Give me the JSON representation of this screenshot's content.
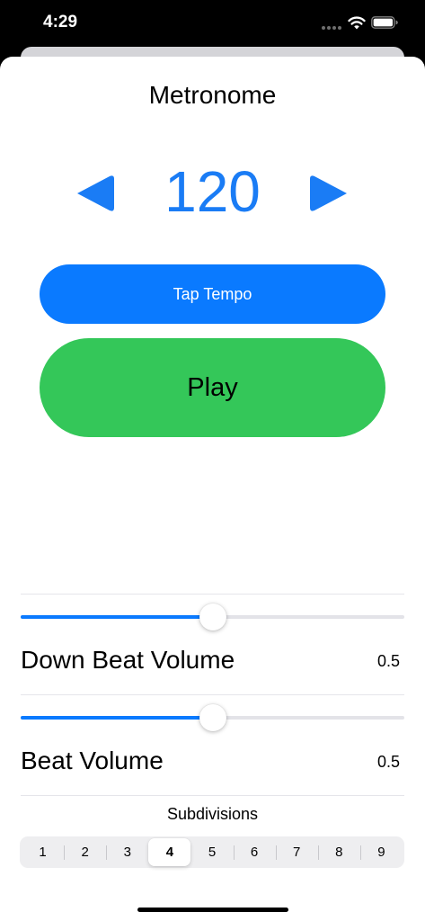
{
  "status_bar": {
    "time": "4:29",
    "icons": [
      "signal-icon",
      "wifi-icon",
      "battery-icon"
    ]
  },
  "page": {
    "title": "Metronome"
  },
  "tempo": {
    "value": "120",
    "decrease_icon": "chevron-left-icon",
    "increase_icon": "chevron-right-icon"
  },
  "buttons": {
    "tap_tempo": "Tap Tempo",
    "play": "Play"
  },
  "down_beat": {
    "label": "Down Beat Volume",
    "value_text": "0.5",
    "level": 0.5
  },
  "beat": {
    "label": "Beat Volume",
    "value_text": "0.5",
    "level": 0.5
  },
  "subdivisions": {
    "title": "Subdivisions",
    "options": [
      "1",
      "2",
      "3",
      "4",
      "5",
      "6",
      "7",
      "8",
      "9"
    ],
    "selected": "4"
  },
  "colors": {
    "accent_blue": "#0a7aff",
    "tempo_blue": "#1a7cf5",
    "play_green": "#34c759"
  }
}
